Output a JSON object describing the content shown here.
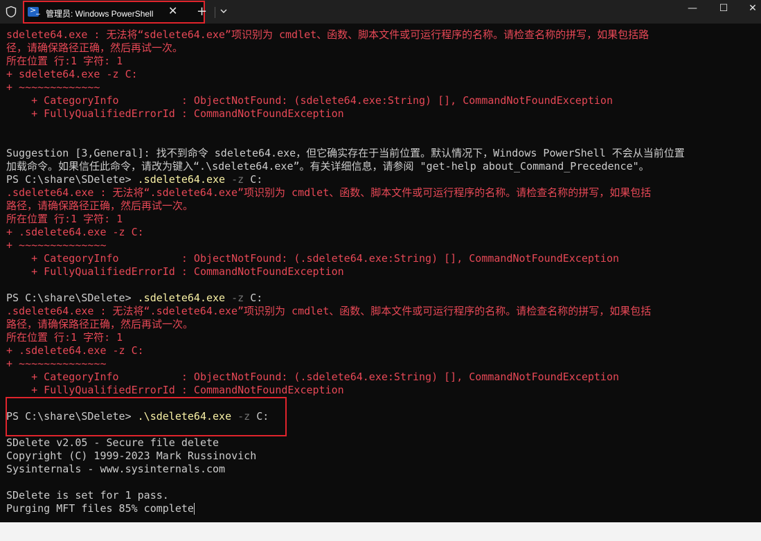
{
  "titlebar": {
    "tab_title": "管理员: Windows PowerShell",
    "tab_icon": "powershell-icon",
    "close_tab": "✕",
    "new_tab": "+",
    "minimize": "—",
    "maximize": "☐",
    "close_window": "✕"
  },
  "terminal": {
    "lines": [
      {
        "segments": [
          {
            "t": "sdelete64.exe : 无法将“sdelete64.exe”项识别为 cmdlet、函数、脚本文件或可运行程序的名称。请检查名称的拼写，如果包括路",
            "c": "err"
          }
        ]
      },
      {
        "segments": [
          {
            "t": "径，请确保路径正确，然后再试一次。",
            "c": "err"
          }
        ]
      },
      {
        "segments": [
          {
            "t": "所在位置 行:1 字符: 1",
            "c": "err"
          }
        ]
      },
      {
        "segments": [
          {
            "t": "+ sdelete64.exe -z C:",
            "c": "err"
          }
        ]
      },
      {
        "segments": [
          {
            "t": "+ ~~~~~~~~~~~~~",
            "c": "err"
          }
        ]
      },
      {
        "segments": [
          {
            "t": "    + CategoryInfo          : ObjectNotFound: (sdelete64.exe:String) [], CommandNotFoundException",
            "c": "err"
          }
        ]
      },
      {
        "segments": [
          {
            "t": "    + FullyQualifiedErrorId : CommandNotFoundException",
            "c": "err"
          }
        ]
      },
      {
        "segments": [
          {
            "t": "",
            "c": ""
          }
        ]
      },
      {
        "segments": [
          {
            "t": "",
            "c": ""
          }
        ]
      },
      {
        "segments": [
          {
            "t": "Suggestion [3,General]: 找不到命令 sdelete64.exe，但它确实存在于当前位置。默认情况下，Windows PowerShell 不会从当前位置",
            "c": ""
          }
        ]
      },
      {
        "segments": [
          {
            "t": "加载命令。如果信任此命令，请改为键入“.\\sdelete64.exe”。有关详细信息，请参阅 \"get-help about_Command_Precedence\"。",
            "c": ""
          }
        ]
      },
      {
        "segments": [
          {
            "t": "PS C:\\share\\SDelete> ",
            "c": ""
          },
          {
            "t": ".sdelete64.exe",
            "c": "cmd"
          },
          {
            "t": " -z",
            "c": "param"
          },
          {
            "t": " C:",
            "c": ""
          }
        ]
      },
      {
        "segments": [
          {
            "t": ".sdelete64.exe : 无法将“.sdelete64.exe”项识别为 cmdlet、函数、脚本文件或可运行程序的名称。请检查名称的拼写，如果包括",
            "c": "err"
          }
        ]
      },
      {
        "segments": [
          {
            "t": "路径，请确保路径正确，然后再试一次。",
            "c": "err"
          }
        ]
      },
      {
        "segments": [
          {
            "t": "所在位置 行:1 字符: 1",
            "c": "err"
          }
        ]
      },
      {
        "segments": [
          {
            "t": "+ .sdelete64.exe -z C:",
            "c": "err"
          }
        ]
      },
      {
        "segments": [
          {
            "t": "+ ~~~~~~~~~~~~~~",
            "c": "err"
          }
        ]
      },
      {
        "segments": [
          {
            "t": "    + CategoryInfo          : ObjectNotFound: (.sdelete64.exe:String) [], CommandNotFoundException",
            "c": "err"
          }
        ]
      },
      {
        "segments": [
          {
            "t": "    + FullyQualifiedErrorId : CommandNotFoundException",
            "c": "err"
          }
        ]
      },
      {
        "segments": [
          {
            "t": "",
            "c": ""
          }
        ]
      },
      {
        "segments": [
          {
            "t": "PS C:\\share\\SDelete> ",
            "c": ""
          },
          {
            "t": ".sdelete64.exe",
            "c": "cmd"
          },
          {
            "t": " -z",
            "c": "param"
          },
          {
            "t": " C:",
            "c": ""
          }
        ]
      },
      {
        "segments": [
          {
            "t": ".sdelete64.exe : 无法将“.sdelete64.exe”项识别为 cmdlet、函数、脚本文件或可运行程序的名称。请检查名称的拼写，如果包括",
            "c": "err"
          }
        ]
      },
      {
        "segments": [
          {
            "t": "路径，请确保路径正确，然后再试一次。",
            "c": "err"
          }
        ]
      },
      {
        "segments": [
          {
            "t": "所在位置 行:1 字符: 1",
            "c": "err"
          }
        ]
      },
      {
        "segments": [
          {
            "t": "+ .sdelete64.exe -z C:",
            "c": "err"
          }
        ]
      },
      {
        "segments": [
          {
            "t": "+ ~~~~~~~~~~~~~~",
            "c": "err"
          }
        ]
      },
      {
        "segments": [
          {
            "t": "    + CategoryInfo          : ObjectNotFound: (.sdelete64.exe:String) [], CommandNotFoundException",
            "c": "err"
          }
        ]
      },
      {
        "segments": [
          {
            "t": "    + FullyQualifiedErrorId : CommandNotFoundException",
            "c": "err"
          }
        ]
      },
      {
        "segments": [
          {
            "t": "",
            "c": ""
          }
        ]
      },
      {
        "segments": [
          {
            "t": "PS C:\\share\\SDelete> ",
            "c": ""
          },
          {
            "t": ".\\sdelete64.exe",
            "c": "cmd"
          },
          {
            "t": " -z",
            "c": "param"
          },
          {
            "t": " C:",
            "c": ""
          }
        ]
      },
      {
        "segments": [
          {
            "t": "",
            "c": ""
          }
        ]
      },
      {
        "segments": [
          {
            "t": "SDelete v2.05 - Secure file delete",
            "c": ""
          }
        ]
      },
      {
        "segments": [
          {
            "t": "Copyright (C) 1999-2023 Mark Russinovich",
            "c": ""
          }
        ]
      },
      {
        "segments": [
          {
            "t": "Sysinternals - www.sysinternals.com",
            "c": ""
          }
        ]
      },
      {
        "segments": [
          {
            "t": "",
            "c": ""
          }
        ]
      },
      {
        "segments": [
          {
            "t": "SDelete is set for 1 pass.",
            "c": ""
          }
        ]
      },
      {
        "segments": [
          {
            "t": "Purging MFT files 85% complete",
            "c": ""
          }
        ],
        "cursor": true
      }
    ]
  },
  "colors": {
    "background": "#0c0c0c",
    "text": "#cccccc",
    "error": "#e74856",
    "command": "#f9f1a5",
    "parameter": "#767676",
    "highlight_box": "#e0242c"
  }
}
